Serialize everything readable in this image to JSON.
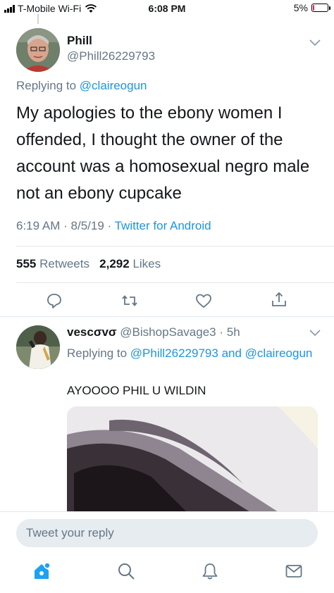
{
  "status_bar": {
    "carrier": "T-Mobile Wi-Fi",
    "time": "6:08 PM",
    "battery_percent": "5%",
    "battery_level": 0.05
  },
  "tweet": {
    "display_name": "Phill",
    "handle": "@Phill26229793",
    "replying_prefix": "Replying to",
    "replying_to": "@claireogun",
    "text": "My apologies to the ebony women I offended, I thought the owner of the account was a homosexual negro male not an ebony cupcake",
    "time": "6:19 AM",
    "date": "8/5/19",
    "separator": "·",
    "source": "Twitter for Android",
    "retweets_count": "555",
    "retweets_label": "Retweets",
    "likes_count": "2,292",
    "likes_label": "Likes"
  },
  "reply": {
    "display_name": "vescσvσ",
    "handle": "@BishopSavage3",
    "age": "· 5h",
    "replying_prefix": "Replying to",
    "replying_to_1": "@Phill26229793",
    "and": "and",
    "replying_to_2": "@claireogun",
    "text": "AYOOOO PHIL U WILDIN"
  },
  "compose": {
    "placeholder": "Tweet your reply"
  },
  "icons": {
    "reply": "reply-icon",
    "retweet": "retweet-icon",
    "like": "heart-icon",
    "share": "share-icon",
    "home": "home-icon",
    "search": "search-icon",
    "notifications": "bell-icon",
    "messages": "envelope-icon"
  },
  "colors": {
    "accent": "#1b95e0",
    "secondary_text": "#657786",
    "primary_text": "#14171a",
    "battery_low": "#e0245e"
  }
}
